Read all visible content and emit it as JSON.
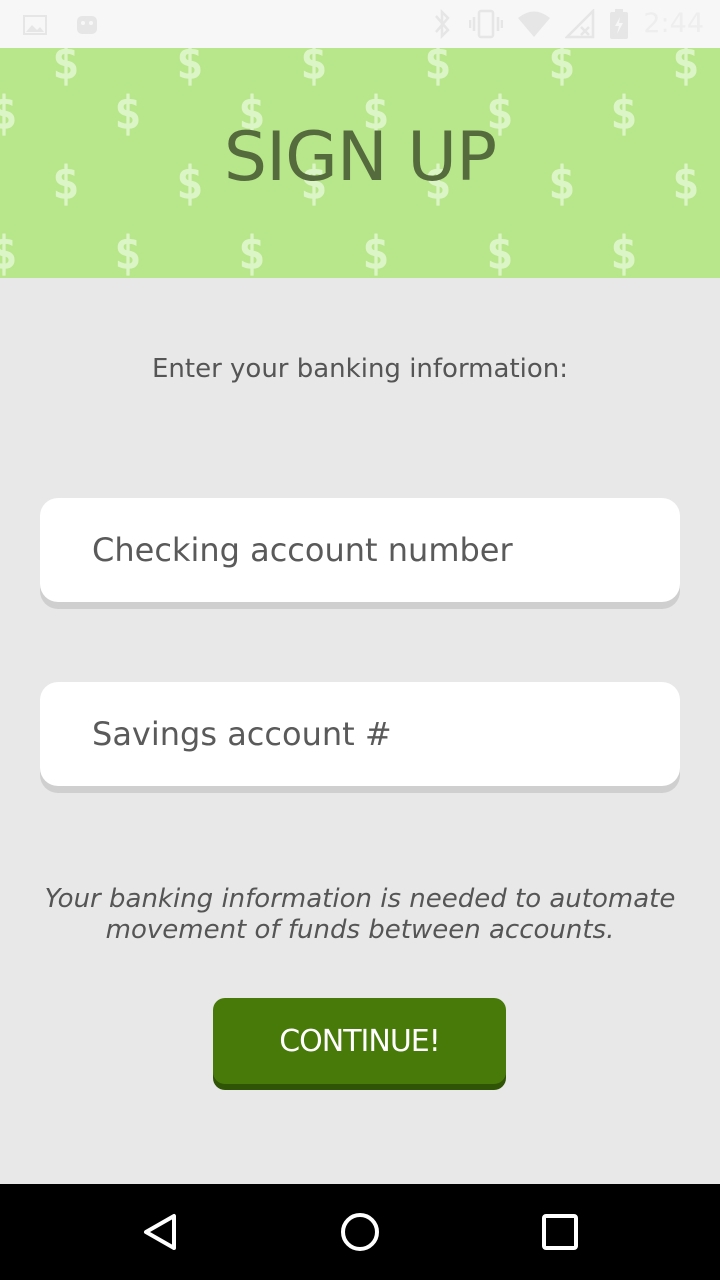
{
  "status_bar": {
    "time": "2:44",
    "left_icons": [
      "image-icon",
      "android-debug-icon"
    ],
    "right_icons": [
      "bluetooth-icon",
      "vibrate-icon",
      "wifi-icon",
      "no-signal-icon",
      "battery-charging-icon"
    ]
  },
  "header": {
    "title": "SIGN UP",
    "background_color": "#b8e68a",
    "pattern_icon": "dollar-sign-icon"
  },
  "form": {
    "instruction": "Enter your banking information:",
    "checking_placeholder": "Checking account number",
    "checking_value": "",
    "savings_placeholder": "Savings account #",
    "savings_value": "",
    "note": "Your banking information is needed to automate movement of funds between accounts.",
    "continue_label": "CONTINUE!"
  },
  "nav_bar": {
    "buttons": [
      "back-icon",
      "home-icon",
      "recents-icon"
    ]
  },
  "colors": {
    "accent": "#477a08",
    "title": "#556b3d",
    "background": "#e8e8e8"
  }
}
